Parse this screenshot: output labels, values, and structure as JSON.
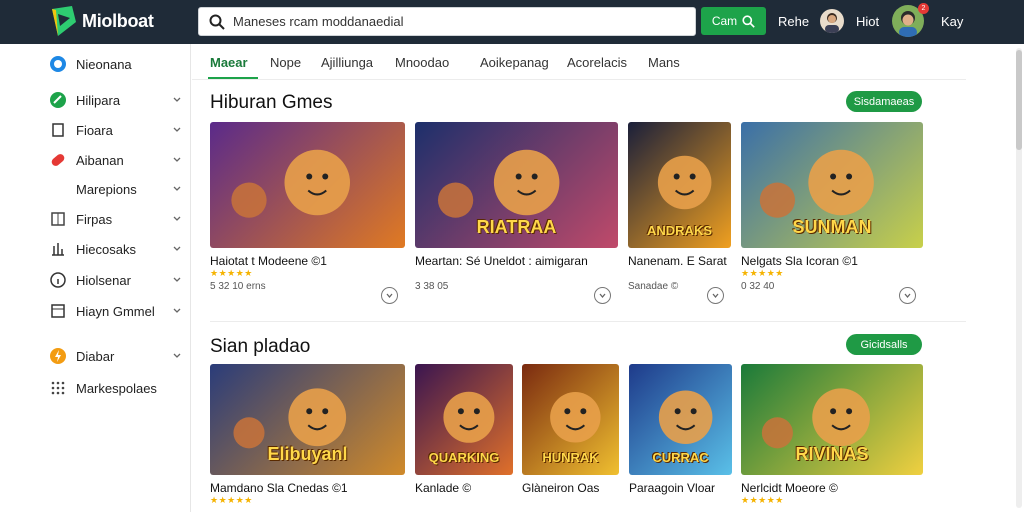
{
  "app": {
    "name": "Miolboat"
  },
  "search": {
    "placeholder": "Maneses rcam moddanaedial",
    "button_label": "Cam"
  },
  "header": {
    "link1": "Rehe",
    "link2": "Hiot",
    "link3": "Kay",
    "badge_count": "2"
  },
  "sidebar": {
    "items": [
      {
        "label": "Nieonana",
        "icon": "chat-bubble-icon",
        "chevron": false
      },
      {
        "label": "Hilipara",
        "icon": "leaf-icon",
        "chevron": true
      },
      {
        "label": "Fioara",
        "icon": "bookmark-icon",
        "chevron": true
      },
      {
        "label": "Aibanan",
        "icon": "pill-icon",
        "chevron": true
      },
      {
        "label": "Marepions",
        "icon": "",
        "chevron": true
      },
      {
        "label": "Firpas",
        "icon": "grid-icon",
        "chevron": true
      },
      {
        "label": "Hiecosaks",
        "icon": "bar-chart-icon",
        "chevron": true
      },
      {
        "label": "Hiolsenar",
        "icon": "info-icon",
        "chevron": true
      },
      {
        "label": "Hiayn Gmmel",
        "icon": "window-icon",
        "chevron": true
      },
      {
        "label": "Diabar",
        "icon": "flash-icon",
        "chevron": true
      },
      {
        "label": "Markespolaes",
        "icon": "dots-grid-icon",
        "chevron": false
      }
    ]
  },
  "tabs": [
    {
      "label": "Maear",
      "active": true
    },
    {
      "label": "Nope",
      "active": false
    },
    {
      "label": "Ajilliunga",
      "active": false
    },
    {
      "label": "Mnoodao",
      "active": false
    },
    {
      "label": "Aoikepanag",
      "active": false
    },
    {
      "label": "Acorelacis",
      "active": false
    },
    {
      "label": "Mans",
      "active": false
    }
  ],
  "section1": {
    "title": "Hiburan Gmes",
    "see_all": "Sisdamaeas",
    "cards": [
      {
        "title": "Haiotat t Modeene ©1",
        "stars": "★★★★★",
        "meta": "5 32 10 erns",
        "art_text": ""
      },
      {
        "title": "Meartan: Sé Uneldot : aimigaran",
        "stars": "",
        "meta": "3 38 05",
        "art_text": "RIATRAA"
      },
      {
        "title": "Nanenam. E Sarat",
        "stars": "",
        "meta": "Sanadae ©",
        "art_text": "ANDRAKS"
      },
      {
        "title": "Nelgats Sla Icoran ©1",
        "stars": "★★★★★",
        "meta": "0 32 40",
        "art_text": "SUNMAN"
      }
    ]
  },
  "section2": {
    "title": "Sian pladao",
    "see_all": "Gicidsalls",
    "cards": [
      {
        "title": "Mamdano Sla Cnedas ©1",
        "stars": "★★★★★",
        "art_text": "Elibuyanl"
      },
      {
        "title": "Kanlade ©",
        "stars": "",
        "art_text": "QUARKING"
      },
      {
        "title": "Glàneiron Oas",
        "stars": "",
        "art_text": "HUNRAK"
      },
      {
        "title": "Paraagoin Vloar",
        "stars": "",
        "art_text": "CURRAC"
      },
      {
        "title": "Nerlcidt Moeore ©",
        "stars": "★★★★★",
        "art_text": "RIVINAS"
      }
    ]
  },
  "colors": {
    "topbar": "#1f2b38",
    "accent": "#1da34a",
    "star": "#f5b301"
  }
}
